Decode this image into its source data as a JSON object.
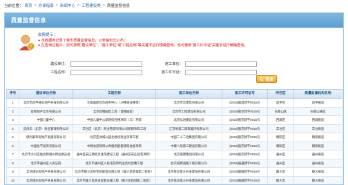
{
  "breadcrumb": {
    "prefix": "当前位置：",
    "items": [
      "首页",
      "办事指南",
      "新闻中心",
      "工程建设类",
      "质量监督信息"
    ]
  },
  "panel": {
    "title": "质量监督信息"
  },
  "tips": {
    "title": "友情提示：",
    "lines": [
      "● 本数据库记录了我市质量监督信息，以表格形式公布；",
      "● 在查询过程中，您可按照“建设单位”、“施工单位”或“工程名称”等关键字进行模糊查询，也可使用“施工许可证”关键字进行精确查询。"
    ]
  },
  "search": {
    "fields": [
      {
        "label": "建设单位：",
        "value": ""
      },
      {
        "label": "施工单位：",
        "value": ""
      },
      {
        "label": "工程名称：",
        "value": ""
      },
      {
        "label": "施工许可证：",
        "value": ""
      }
    ],
    "button_label": "查询"
  },
  "table": {
    "headers": [
      "序号",
      "建设单位名称",
      "工程名称",
      "施工单位名称",
      "施工许可证号",
      "所在区",
      "质量监督机构名称"
    ],
    "rows": [
      [
        "1",
        "北京市昌平县房地产开发有限公司",
        "文成国际综合商务中心（1#楼商业楼等）",
        "北京市华建筑有限公司",
        "[2019]施昌建字0015号",
        "昌平区",
        "昌平质监"
      ],
      [
        "2",
        "首钢地产北京有限公司",
        "北京首钢园区工程（首钢园区）",
        "北京市工程建设有限公司",
        "[2019]施京建字0015号",
        "石景山区",
        "石景山质监"
      ],
      [
        "3",
        "中国儿童中心",
        "中国儿童中心新建综合楼项目（三）项目",
        "北京弘进建设有限公司",
        "[2019]施京建字0015号",
        "西城区",
        "西城质监"
      ],
      [
        "4",
        "首创华（北京）商业管理有限公司",
        "丰台区（北京）商业管理有限公司新建项目工程",
        "江苏省第二建筑集团有限公司",
        "[2019]施京建字0015号",
        "丰台区",
        "丰台质监"
      ],
      [
        "5",
        "保利泰禾房地产发展有限公司",
        "北京亚洲城公园北地块商业项目工程",
        "中国二十二冶集团有限公司",
        "[2019]施京建字0015号",
        "朝阳区",
        "朝阳质监"
      ],
      [
        "6",
        "中国化学投资有限公司",
        "中建总部项目公共服务配套建筑协会项目",
        "中建八局第三建设有限公司",
        "[2019]施京建字0016号",
        "朝阳区",
        "朝阳质监"
      ],
      [
        "7",
        "北京市大兴区住房和城乡建设委员会",
        "通州区宋庄镇北京住宅建设工程（通州区宋庄住宅项目）",
        "北京城建集团有限公司",
        "[2019]施京建字0016号",
        "通州区",
        "通州质监"
      ],
      [
        "8",
        "北京市通州区人民法院",
        "北京市通州区人民法院审判业务综合楼工程",
        "北京城建道路工程有限公司",
        "[2019]施通建字0016号",
        "通州区",
        "通州质监"
      ],
      [
        "9",
        "北京顺达房地产开发有限公司",
        "北京市顺义区住宅及配套设施工程（顺义区新城第二街区）",
        "北京住总第三开发建设有限公司",
        "[2019]施顺建字0016号",
        "顺义区",
        "顺义质监"
      ],
      [
        "10",
        "北京顺达房地产开发有限公司",
        "北京市顺义区商业配套设施工程（顺义区新城第二街区）",
        "北京住总第三开发建设有限公司",
        "[2019]施顺建字0016号",
        "顺义区",
        "顺义质监"
      ],
      [
        "11",
        "北京顺达房地产开发有限公司",
        "北京市顺义区配套工程（顺义区新城第二街区）",
        "北京住总第三开发建设有限公司",
        "[2019]施顺建字0016号",
        "顺义区",
        "顺义质监"
      ]
    ]
  },
  "colors": {
    "header": "#5d9fd3",
    "tips_red": "#e10000",
    "button": "#f5a623"
  }
}
